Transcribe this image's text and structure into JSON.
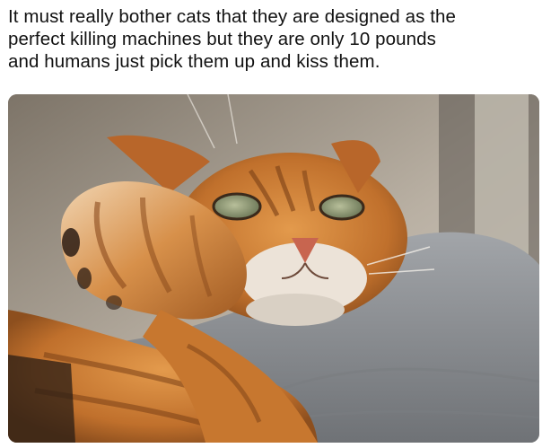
{
  "post": {
    "caption": "It must really bother cats that they are designed as the\nperfect killing machines but they are only 10 pounds\nand humans just pick them up and kiss them.",
    "photo_subject": "orange-tabby-cat-on-grey-cushion"
  },
  "colors": {
    "background": "#ffffff",
    "text": "#111111",
    "fur": "#c7772f",
    "cushion": "#8c8f93"
  }
}
